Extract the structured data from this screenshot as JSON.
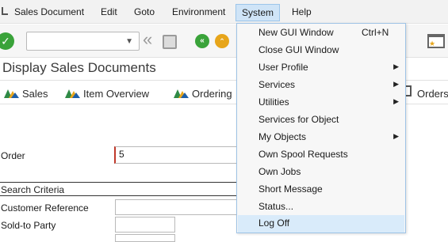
{
  "menubar": {
    "items": [
      {
        "label": "Sales Document"
      },
      {
        "label": "Edit"
      },
      {
        "label": "Goto"
      },
      {
        "label": "Environment"
      },
      {
        "label": "System"
      },
      {
        "label": "Help"
      }
    ]
  },
  "toolbar": {
    "command_field_value": "",
    "enter_icon": "check-icon",
    "back_icon": "double-left-arrow-icon",
    "save_icon": "save-icon",
    "back_green_icon": "back-icon",
    "exit_icon": "exit-icon",
    "layout_icon": "customize-layout-icon"
  },
  "page": {
    "title": "Display Sales Documents"
  },
  "app_toolbar": {
    "buttons": [
      {
        "label": "Sales"
      },
      {
        "label": "Item Overview"
      },
      {
        "label": "Ordering"
      },
      {
        "label": "Orders"
      }
    ]
  },
  "form": {
    "order_label": "Order",
    "order_value": "5",
    "section_title": "Search Criteria",
    "customer_reference_label": "Customer Reference",
    "sold_to_party_label": "Sold-to Party"
  },
  "system_menu": {
    "items": [
      {
        "label": "New GUI Window",
        "shortcut": "Ctrl+N",
        "submenu": false
      },
      {
        "label": "Close GUI Window",
        "shortcut": "",
        "submenu": false
      },
      {
        "label": "User Profile",
        "shortcut": "",
        "submenu": true
      },
      {
        "label": "Services",
        "shortcut": "",
        "submenu": true
      },
      {
        "label": "Utilities",
        "shortcut": "",
        "submenu": true
      },
      {
        "label": "Services for Object",
        "shortcut": "",
        "submenu": false
      },
      {
        "label": "My Objects",
        "shortcut": "",
        "submenu": true
      },
      {
        "label": "Own Spool Requests",
        "shortcut": "",
        "submenu": false
      },
      {
        "label": "Own Jobs",
        "shortcut": "",
        "submenu": false
      },
      {
        "label": "Short Message",
        "shortcut": "",
        "submenu": false
      },
      {
        "label": "Status...",
        "shortcut": "",
        "submenu": false
      },
      {
        "label": "Log Off",
        "shortcut": "",
        "submenu": false,
        "highlighted": true
      }
    ]
  },
  "colors": {
    "menu_highlight": "#d9ebfa",
    "menu_border": "#9ec3e6",
    "accent_green": "#3aa33a",
    "accent_orange": "#e7a51a",
    "required_marker": "#c0392b"
  }
}
